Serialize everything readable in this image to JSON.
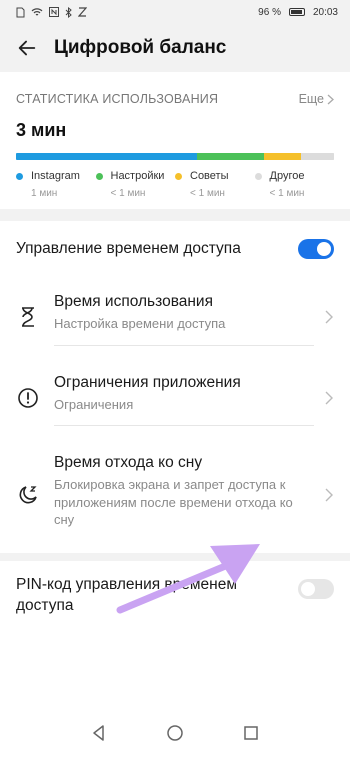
{
  "status_bar": {
    "battery_percent": "96 %",
    "time": "20:03"
  },
  "header": {
    "title": "Цифровой баланс"
  },
  "stats": {
    "label": "СТАТИСТИКА ИСПОЛЬЗОВАНИЯ",
    "more": "Еще",
    "total": "3 мин",
    "bar_fractions": [
      0.57,
      0.21,
      0.115,
      0.105
    ],
    "legend": [
      {
        "name": "Instagram",
        "value": "1 мин",
        "color": "#1e9be0"
      },
      {
        "name": "Настройки",
        "value": "< 1 мин",
        "color": "#4cc159"
      },
      {
        "name": "Советы",
        "value": "< 1 мин",
        "color": "#f5c02a"
      },
      {
        "name": "Другое",
        "value": "< 1 мин",
        "color": "#dcdcdc"
      }
    ]
  },
  "access_control": {
    "label": "Управление временем доступа",
    "enabled": true
  },
  "items": [
    {
      "title": "Время использования",
      "subtitle": "Настройка времени доступа",
      "icon": "hourglass-icon"
    },
    {
      "title": "Ограничения приложения",
      "subtitle": "Ограничения",
      "icon": "alert-circle-icon"
    },
    {
      "title": "Время отхода ко сну",
      "subtitle": "Блокировка экрана и запрет доступа к приложениям после времени отхода ко сну",
      "icon": "moon-sleep-icon"
    }
  ],
  "pin": {
    "label": "PIN-код управления временем доступа",
    "enabled": false
  },
  "accent_color": "#1a73e8",
  "annotation_arrow_color": "#c9a3f2"
}
